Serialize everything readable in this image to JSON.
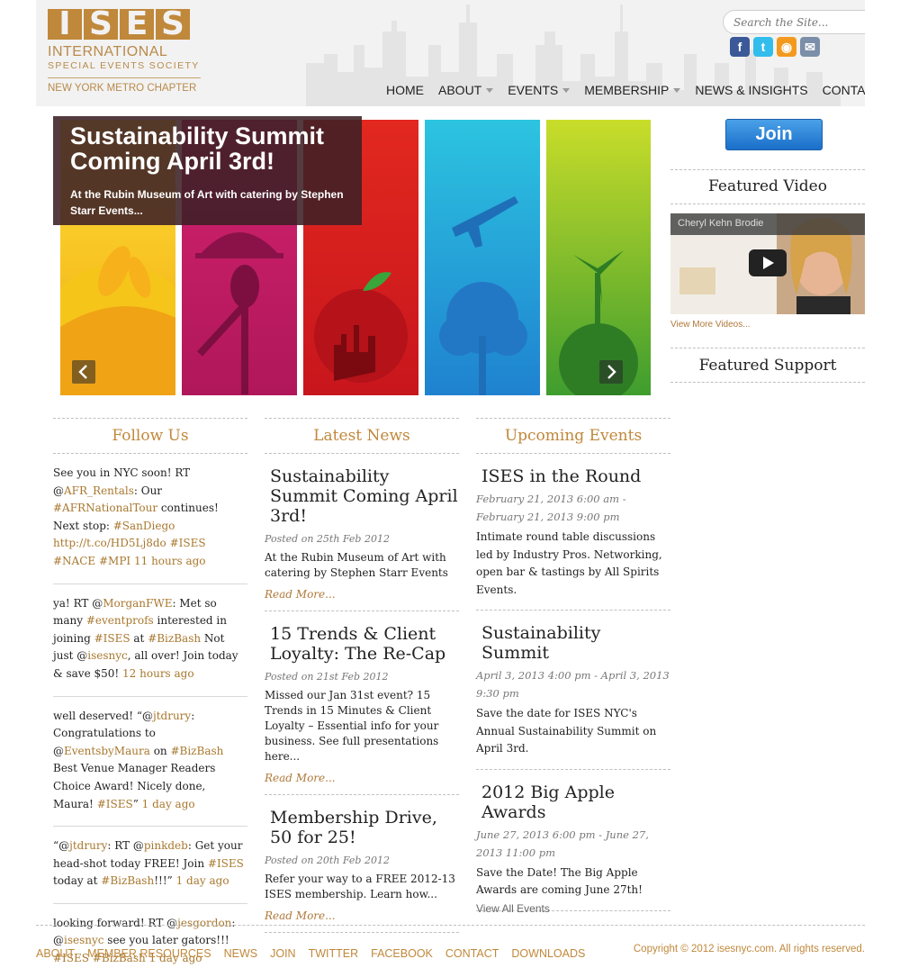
{
  "header": {
    "logo": {
      "letters": [
        "I",
        "S",
        "E",
        "S"
      ],
      "line1": "INTERNATIONAL",
      "line2": "SPECIAL EVENTS SOCIETY",
      "chapter": "NEW YORK METRO CHAPTER"
    },
    "search": {
      "placeholder": "Search the Site..."
    },
    "social": [
      {
        "icon": "facebook-icon",
        "glyph": "f",
        "color": "#3b5998"
      },
      {
        "icon": "twitter-icon",
        "glyph": "t",
        "color": "#33bdec"
      },
      {
        "icon": "rss-icon",
        "glyph": "◉",
        "color": "#f39a1e"
      },
      {
        "icon": "email-icon",
        "glyph": "✉",
        "color": "#7b8fa8"
      }
    ],
    "nav": [
      {
        "label": "HOME",
        "dropdown": false
      },
      {
        "label": "ABOUT",
        "dropdown": true
      },
      {
        "label": "EVENTS",
        "dropdown": true
      },
      {
        "label": "MEMBERSHIP",
        "dropdown": true
      },
      {
        "label": "NEWS & INSIGHTS",
        "dropdown": false
      },
      {
        "label": "CONTACT",
        "dropdown": false
      }
    ]
  },
  "hero": {
    "title": "Sustainability Summit Coming April 3rd!",
    "text": "At the Rubin Museum of Art with catering by Stephen Starr Events...",
    "panel_colors": [
      "#f3c316",
      "#c21d69",
      "#e2281f",
      "#3a9fe0",
      "#3f9d2e"
    ]
  },
  "sidebar": {
    "join_label": "Join",
    "featured_video_heading": "Featured Video",
    "video_title": "Cheryl Kehn Brodie",
    "more_videos": "View More Videos...",
    "featured_support_heading": "Featured Support"
  },
  "follow_us": {
    "heading": "Follow Us",
    "tweets": [
      [
        {
          "t": "See you in NYC soon! RT @",
          "h": false
        },
        {
          "t": "AFR_Rentals",
          "h": true
        },
        {
          "t": ": Our ",
          "h": false
        },
        {
          "t": "#AFRNationalTour",
          "h": true
        },
        {
          "t": " continues! Next stop: ",
          "h": false
        },
        {
          "t": "#SanDiego",
          "h": true
        },
        {
          "t": " ",
          "h": false
        },
        {
          "t": "http://t.co/HD5Lj8do",
          "h": true
        },
        {
          "t": " ",
          "h": false
        },
        {
          "t": "#ISES",
          "h": true
        },
        {
          "t": " ",
          "h": false
        },
        {
          "t": "#NACE",
          "h": true
        },
        {
          "t": " ",
          "h": false
        },
        {
          "t": "#MPI",
          "h": true
        },
        {
          "t": " ",
          "h": false
        },
        {
          "t": "11 hours ago",
          "h": true
        }
      ],
      [
        {
          "t": "ya! RT @",
          "h": false
        },
        {
          "t": "MorganFWE",
          "h": true
        },
        {
          "t": ": Met so many ",
          "h": false
        },
        {
          "t": "#eventprofs",
          "h": true
        },
        {
          "t": " interested in joining ",
          "h": false
        },
        {
          "t": "#ISES",
          "h": true
        },
        {
          "t": " at ",
          "h": false
        },
        {
          "t": "#BizBash",
          "h": true
        },
        {
          "t": " Not just @",
          "h": false
        },
        {
          "t": "isesnyc",
          "h": true
        },
        {
          "t": ", all over! Join today & save $50! ",
          "h": false
        },
        {
          "t": "12 hours ago",
          "h": true
        }
      ],
      [
        {
          "t": "well deserved! “@",
          "h": false
        },
        {
          "t": "jtdrury",
          "h": true
        },
        {
          "t": ": Congratulations to @",
          "h": false
        },
        {
          "t": "EventsbyMaura",
          "h": true
        },
        {
          "t": " on ",
          "h": false
        },
        {
          "t": "#BizBash",
          "h": true
        },
        {
          "t": " Best Venue Manager Readers Choice Award! Nicely done, Maura! ",
          "h": false
        },
        {
          "t": "#ISES",
          "h": true
        },
        {
          "t": "” ",
          "h": false
        },
        {
          "t": "1 day ago",
          "h": true
        }
      ],
      [
        {
          "t": "“@",
          "h": false
        },
        {
          "t": "jtdrury",
          "h": true
        },
        {
          "t": ": RT @",
          "h": false
        },
        {
          "t": "pinkdeb",
          "h": true
        },
        {
          "t": ": Get your head-shot today FREE! Join ",
          "h": false
        },
        {
          "t": "#ISES",
          "h": true
        },
        {
          "t": " today at ",
          "h": false
        },
        {
          "t": "#BizBash",
          "h": true
        },
        {
          "t": "!!!” ",
          "h": false
        },
        {
          "t": "1 day ago",
          "h": true
        }
      ],
      [
        {
          "t": "looking forward! RT @",
          "h": false
        },
        {
          "t": "jesgordon",
          "h": true
        },
        {
          "t": ": @",
          "h": false
        },
        {
          "t": "isesnyc",
          "h": true
        },
        {
          "t": " see you later gators!!! ",
          "h": false
        },
        {
          "t": "#ISES",
          "h": true
        },
        {
          "t": " ",
          "h": false
        },
        {
          "t": "#BizBash",
          "h": true
        },
        {
          "t": " ",
          "h": false
        },
        {
          "t": "1 day ago",
          "h": true
        }
      ]
    ]
  },
  "latest_news": {
    "heading": "Latest News",
    "posts": [
      {
        "title": "Sustainability Summit Coming April 3rd!",
        "date": "Posted on 25th Feb 2012",
        "body": "At the Rubin Museum of Art with catering by Stephen Starr Events",
        "read_more": "Read More..."
      },
      {
        "title": "15 Trends & Client Loyalty: The Re-Cap",
        "date": "Posted on 21st Feb 2012",
        "body": "Missed our Jan 31st event? 15 Trends in 15 Minutes & Client Loyalty – Essential info for your business. See full presentations here...",
        "read_more": "Read More..."
      },
      {
        "title": "Membership Drive, 50 for 25!",
        "date": "Posted on 20th Feb 2012",
        "body": "Refer your way to a FREE 2012-13 ISES membership. Learn how...",
        "read_more": "Read More..."
      }
    ]
  },
  "upcoming_events": {
    "heading": "Upcoming Events",
    "events": [
      {
        "title": "ISES in the Round",
        "date": "February 21, 2013 6:00 am - February 21, 2013 9:00 pm",
        "body": "Intimate round table discussions led by Industry Pros. Networking, open bar & tastings by All Spirits Events."
      },
      {
        "title": "Sustainability Summit",
        "date": "April 3, 2013 4:00 pm - April 3, 2013 9:30 pm",
        "body": "Save the date for ISES NYC's Annual Sustainability Summit on April 3rd."
      },
      {
        "title": "2012 Big Apple Awards",
        "date": "June 27, 2013 6:00 pm - June 27, 2013 11:00 pm",
        "body": "Save the Date! The Big Apple Awards are coming June 27th!"
      }
    ],
    "view_all": "View All Events"
  },
  "footer": {
    "links": [
      "ABOUT",
      "MEMBER RESOURCES",
      "NEWS",
      "JOIN",
      "TWITTER",
      "FACEBOOK",
      "CONTACT",
      "DOWNLOADS"
    ],
    "copyright": "Copyright © 2012 isesnyc.com. All rights reserved."
  }
}
